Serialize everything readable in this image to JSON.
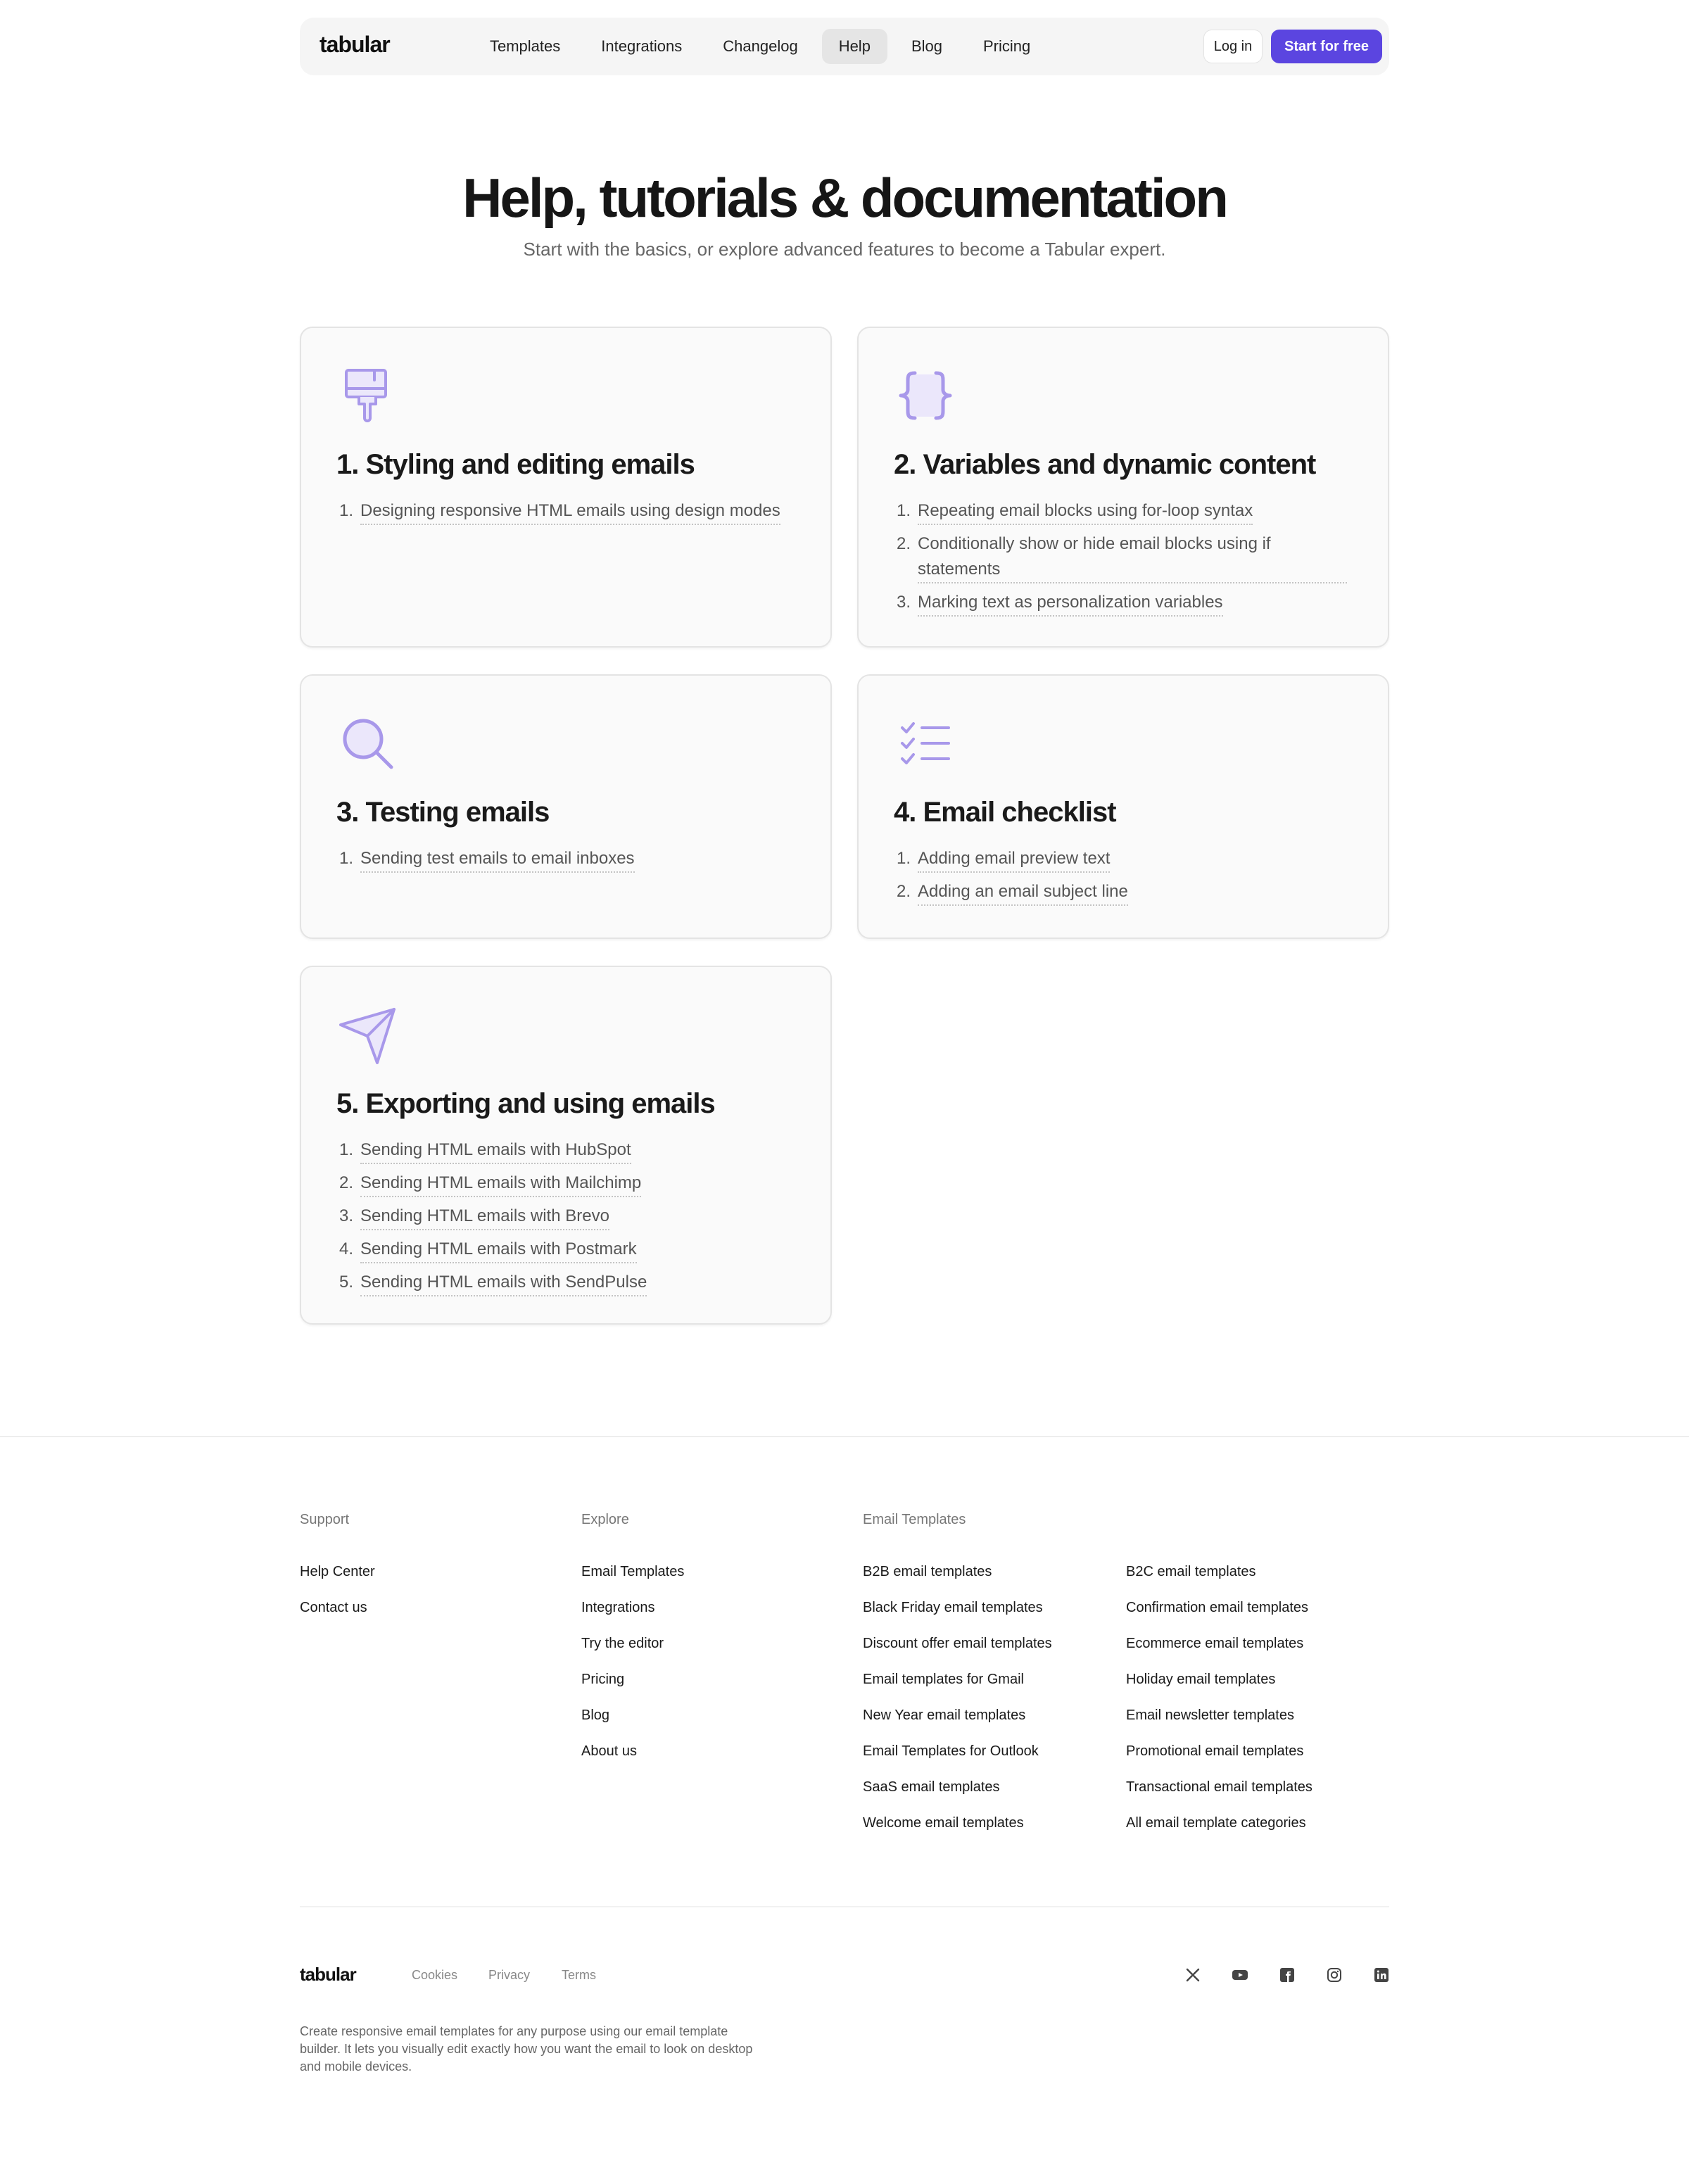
{
  "nav": {
    "logo": "tabular",
    "links": [
      "Templates",
      "Integrations",
      "Changelog",
      "Help",
      "Blog",
      "Pricing"
    ],
    "login": "Log in",
    "start": "Start for free"
  },
  "hero": {
    "title": "Help, tutorials & documentation",
    "subtitle": "Start with the basics, or explore advanced features to become a Tabular expert."
  },
  "accent": "#5b45e0",
  "icon_color": "#a898ea",
  "cards": [
    {
      "icon": "paint-brush-icon",
      "title": "1. Styling and editing emails",
      "items": [
        "Designing responsive HTML emails using design modes"
      ]
    },
    {
      "icon": "curly-braces-icon",
      "title": "2. Variables and dynamic content",
      "items": [
        "Repeating email blocks using for-loop syntax",
        "Conditionally show or hide email blocks using if statements",
        "Marking text as personalization variables"
      ]
    },
    {
      "icon": "magnifier-icon",
      "title": "3. Testing emails",
      "items": [
        "Sending test emails to email inboxes"
      ]
    },
    {
      "icon": "checklist-icon",
      "title": "4. Email checklist",
      "items": [
        "Adding email preview text",
        "Adding an email subject line"
      ]
    },
    {
      "icon": "paper-plane-icon",
      "title": "5. Exporting and using emails",
      "items": [
        "Sending HTML emails with HubSpot",
        "Sending HTML emails with Mailchimp",
        "Sending HTML emails with Brevo",
        "Sending HTML emails with Postmark",
        "Sending HTML emails with SendPulse"
      ]
    }
  ],
  "footer": {
    "support": {
      "heading": "Support",
      "links": [
        "Help Center",
        "Contact us"
      ]
    },
    "explore": {
      "heading": "Explore",
      "links": [
        "Email Templates",
        "Integrations",
        "Try the editor",
        "Pricing",
        "Blog",
        "About us"
      ]
    },
    "templates": {
      "heading": "Email Templates",
      "col1": [
        "B2B email templates",
        "Black Friday email templates",
        "Discount offer email templates",
        "Email templates for Gmail",
        "New Year email templates",
        "Email Templates for Outlook",
        "SaaS email templates",
        "Welcome email templates"
      ],
      "col2": [
        "B2C email templates",
        "Confirmation email templates",
        "Ecommerce email templates",
        "Holiday email templates",
        "Email newsletter templates",
        "Promotional email templates",
        "Transactional email templates",
        "All email template categories"
      ]
    },
    "logo": "tabular",
    "legal": [
      "Cookies",
      "Privacy",
      "Terms"
    ],
    "social": [
      "x-icon",
      "youtube-icon",
      "facebook-icon",
      "instagram-icon",
      "linkedin-icon"
    ],
    "description": "Create responsive email templates for any purpose using our email template builder. It lets you visually edit exactly how you want the email to look on desktop and mobile devices."
  }
}
